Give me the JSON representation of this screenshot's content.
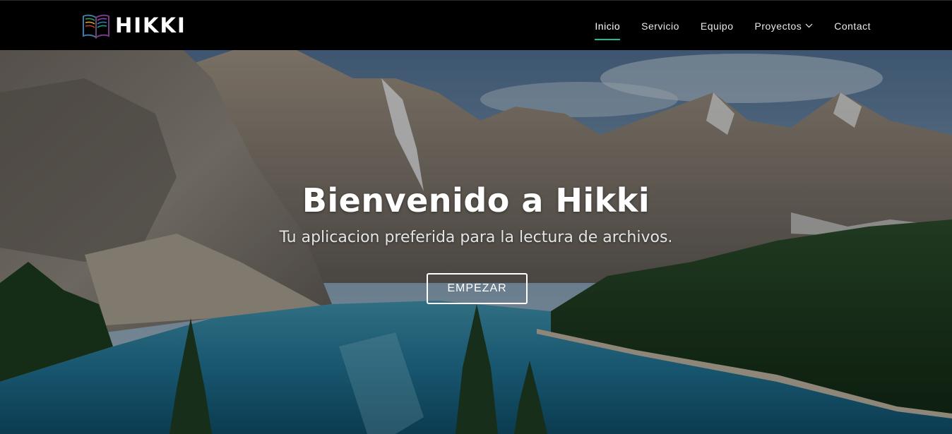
{
  "brand": {
    "name": "HIKKI",
    "logo_icon": "open-book-icon"
  },
  "nav": {
    "items": [
      {
        "label": "Inicio",
        "active": true
      },
      {
        "label": "Servicio",
        "active": false
      },
      {
        "label": "Equipo",
        "active": false
      },
      {
        "label": "Proyectos",
        "active": false,
        "has_dropdown": true,
        "dropdown_icon": "chevron-down-icon"
      },
      {
        "label": "Contact",
        "active": false
      }
    ],
    "active_underline_color": "#1abc9c"
  },
  "hero": {
    "title": "Bienvenido a Hikki",
    "subtitle": "Tu aplicacion preferida para la lectura de archivos.",
    "button_label": "EMPEZAR",
    "background": "mountain-lake-landscape"
  },
  "colors": {
    "navbar_bg": "#000000",
    "accent": "#1abc9c",
    "text": "#ffffff"
  }
}
